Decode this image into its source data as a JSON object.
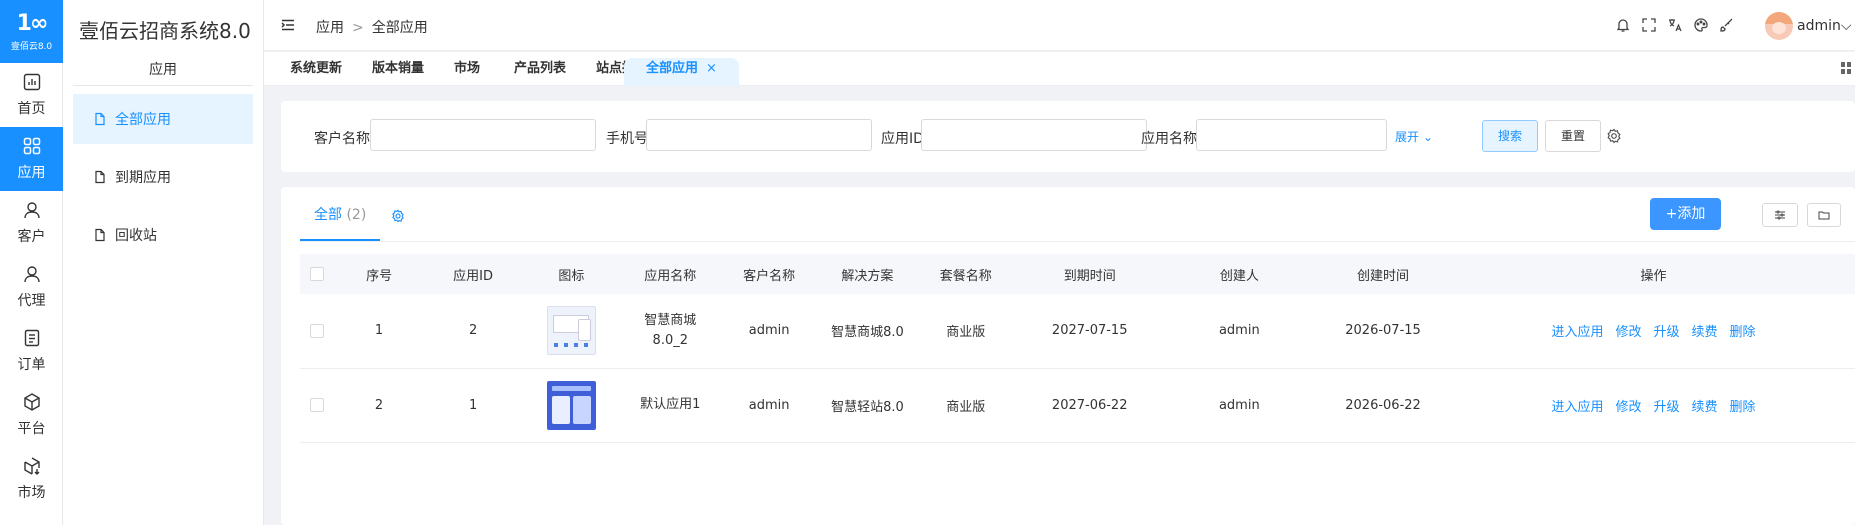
{
  "rail": {
    "logo_mark": "1∞",
    "logo_text": "壹佰云8.0",
    "items": [
      {
        "label": "首页",
        "icon": "chart-icon"
      },
      {
        "label": "应用",
        "icon": "grid-icon",
        "active": true
      },
      {
        "label": "客户",
        "icon": "user-icon"
      },
      {
        "label": "代理",
        "icon": "user-icon"
      },
      {
        "label": "订单",
        "icon": "order-icon"
      },
      {
        "label": "平台",
        "icon": "cube-icon"
      },
      {
        "label": "市场",
        "icon": "package-icon"
      }
    ]
  },
  "sidebar": {
    "title": "壹佰云招商系统8.0",
    "group": "应用",
    "items": [
      {
        "label": "全部应用",
        "active": true
      },
      {
        "label": "到期应用"
      },
      {
        "label": "回收站"
      }
    ]
  },
  "header": {
    "breadcrumb": [
      "应用",
      "全部应用"
    ],
    "breadcrumb_sep": ">",
    "username": "admin",
    "icons": [
      "bell-icon",
      "fullscreen-icon",
      "translate-icon",
      "palette-icon",
      "brush-icon"
    ]
  },
  "tabs": [
    {
      "label": "系统更新"
    },
    {
      "label": "版本销量"
    },
    {
      "label": "市场"
    },
    {
      "label": "产品列表"
    },
    {
      "label": "站点授权"
    },
    {
      "label": "全部应用",
      "active": true,
      "close": "×"
    }
  ],
  "search": {
    "customer_label": "客户名称",
    "phone_label": "手机号",
    "appid_label": "应用ID",
    "appname_label": "应用名称",
    "expand_label": "展开",
    "search_button": "搜索",
    "reset_button": "重置"
  },
  "list": {
    "tab_label": "全部",
    "tab_count": "(2)",
    "add_button": "+添加",
    "columns": [
      "序号",
      "应用ID",
      "图标",
      "应用名称",
      "客户名称",
      "解决方案",
      "套餐名称",
      "到期时间",
      "创建人",
      "创建时间",
      "操作"
    ],
    "rows": [
      {
        "index": "1",
        "app_id": "2",
        "icon": "smart-mall-thumb",
        "name_line1": "智慧商城",
        "name_line2": "8.0_2",
        "customer": "admin",
        "solution": "智慧商城8.0",
        "plan": "商业版",
        "expire": "2027-07-15",
        "creator": "admin",
        "created": "2026-07-15"
      },
      {
        "index": "2",
        "app_id": "1",
        "icon": "smart-site-thumb",
        "name_line1": "默认应用1",
        "name_line2": "",
        "customer": "admin",
        "solution": "智慧轻站8.0",
        "plan": "商业版",
        "expire": "2027-06-22",
        "creator": "admin",
        "created": "2026-06-22"
      }
    ],
    "actions": [
      "进入应用",
      "修改",
      "升级",
      "续费",
      "删除"
    ]
  },
  "colors": {
    "primary": "#1890ff",
    "active_bg": "#e6f4ff",
    "page_bg": "#f0f2f5"
  }
}
